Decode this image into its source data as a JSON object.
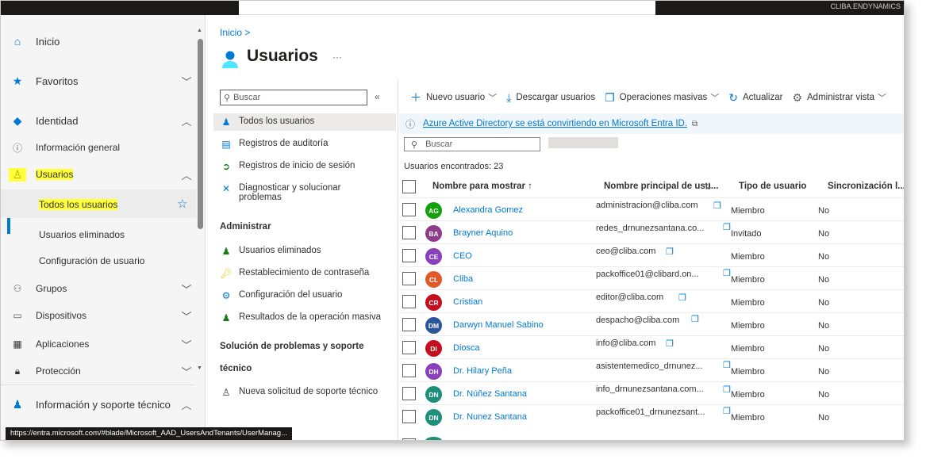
{
  "topbar": {
    "account": "CLIBA.ENDYNAMICS"
  },
  "status_url": "https://entra.microsoft.com/#blade/Microsoft_AAD_UsersAndTenants/UserManag...",
  "nav": {
    "inicio": "Inicio",
    "favoritos": "Favoritos",
    "identidad": "Identidad",
    "info_general": "Información general",
    "usuarios": "Usuarios",
    "todos": "Todos los usuarios",
    "eliminados": "Usuarios eliminados",
    "config": "Configuración de usuario",
    "grupos": "Grupos",
    "dispositivos": "Dispositivos",
    "aplicaciones": "Aplicaciones",
    "proteccion": "Protección",
    "soporte": "Información y soporte técnico"
  },
  "header": {
    "breadcrumb": "Inicio  >",
    "title": "Usuarios",
    "more": "···"
  },
  "menu": {
    "search_placeholder": "Buscar",
    "todos": "Todos los usuarios",
    "auditoria": "Registros de auditoría",
    "inicio_sesion": "Registros de inicio de sesión",
    "diag1": "Diagnosticar y solucionar",
    "diag2": "problemas",
    "administrar": "Administrar",
    "eliminados": "Usuarios eliminados",
    "restablecer": "Restablecimiento de contraseña",
    "config": "Configuración del usuario",
    "resultados": "Resultados de la operación masiva",
    "soporte_sec1": "Solución de problemas y soporte",
    "soporte_sec2": "técnico",
    "nueva": "Nueva solicitud de soporte técnico"
  },
  "toolbar": {
    "nuevo": "Nuevo usuario",
    "descargar": "Descargar usuarios",
    "masivas": "Operaciones masivas",
    "actualizar": "Actualizar",
    "vista": "Administrar vista"
  },
  "banner": {
    "text": "Azure Active Directory se está convirtiendo en Microsoft Entra ID."
  },
  "search": {
    "placeholder": "Buscar"
  },
  "count": "Usuarios encontrados: 23",
  "columns": {
    "nombre": "Nombre para mostrar ↑",
    "upn": "Nombre principal de usu...",
    "tipo": "Tipo de usuario",
    "sync": "Sincronización l..."
  },
  "rows": [
    {
      "initials": "AG",
      "color": "#13a10e",
      "name": "Alexandra Gomez",
      "upn": "administracion@cliba.com",
      "type": "Miembro",
      "sync": "No"
    },
    {
      "initials": "BA",
      "color": "#8e3b8c",
      "name": "Brayner Aquino",
      "upn": "redes_drnunezsantana.co...",
      "type": "Invitado",
      "sync": "No"
    },
    {
      "initials": "CE",
      "color": "#8a3fbf",
      "name": "CEO",
      "upn": "ceo@cliba.com",
      "type": "Miembro",
      "sync": "No"
    },
    {
      "initials": "CL",
      "color": "#e05b2c",
      "name": "Cliba",
      "upn": "packoffice01@clibard.on...",
      "type": "Miembro",
      "sync": "No"
    },
    {
      "initials": "CR",
      "color": "#c50f1f",
      "name": "Cristian",
      "upn": "editor@cliba.com",
      "type": "Miembro",
      "sync": "No"
    },
    {
      "initials": "DM",
      "color": "#2b579a",
      "name": "Darwyn Manuel Sabino",
      "upn": "despacho@cliba.com",
      "type": "Miembro",
      "sync": "No"
    },
    {
      "initials": "DI",
      "color": "#c50f1f",
      "name": "Diosca",
      "upn": "info@cliba.com",
      "type": "Miembro",
      "sync": "No"
    },
    {
      "initials": "DH",
      "color": "#8a3fbf",
      "name": "Dr. Hilary Peña",
      "upn": "asistentemedico_drnunez...",
      "type": "Miembro",
      "sync": "No"
    },
    {
      "initials": "DN",
      "color": "#1d8f7a",
      "name": "Dr. Núñez Santana",
      "upn": "info_drnunezsantana.com...",
      "type": "Miembro",
      "sync": "No"
    },
    {
      "initials": "DN",
      "color": "#1d8f7a",
      "name": "Dr. Nunez Santana",
      "upn": "packoffice01_drnunezsant...",
      "type": "Miembro",
      "sync": "No"
    }
  ]
}
